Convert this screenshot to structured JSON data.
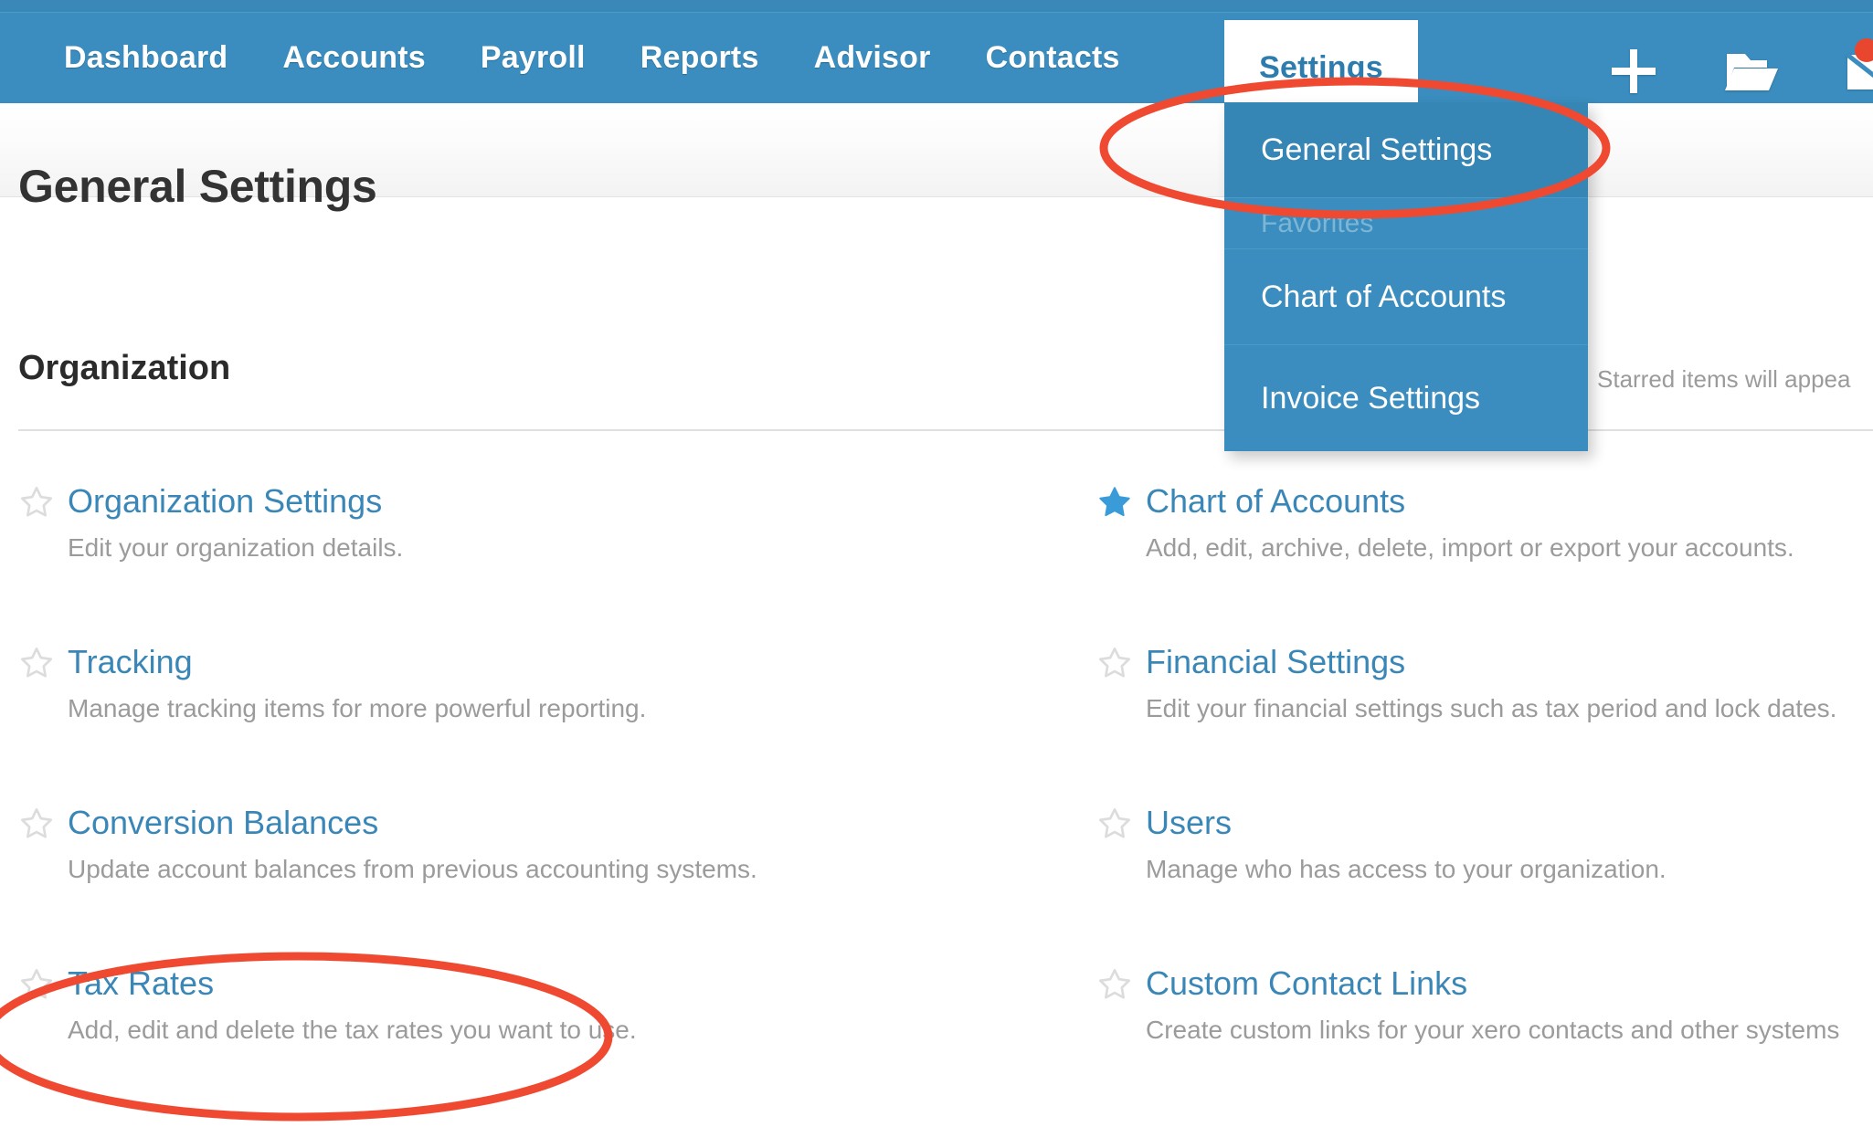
{
  "accent": "#3a8dbe",
  "link_color": "#3a87b7",
  "annotation_color": "#ef4a31",
  "nav": {
    "items": [
      {
        "label": "Dashboard",
        "name": "nav-item-dashboard"
      },
      {
        "label": "Accounts",
        "name": "nav-item-accounts"
      },
      {
        "label": "Payroll",
        "name": "nav-item-payroll"
      },
      {
        "label": "Reports",
        "name": "nav-item-reports"
      },
      {
        "label": "Advisor",
        "name": "nav-item-advisor"
      },
      {
        "label": "Contacts",
        "name": "nav-item-contacts"
      }
    ],
    "active_tab": "Settings",
    "icons": [
      {
        "name": "plus-icon",
        "glyph": "+"
      },
      {
        "name": "folder-icon",
        "glyph": "folder"
      },
      {
        "name": "mail-icon",
        "glyph": "envelope"
      }
    ]
  },
  "dropdown": {
    "selected_item": "General Settings",
    "section_label": "Favorites",
    "favorites": [
      "Chart of Accounts",
      "Invoice Settings"
    ]
  },
  "header": {
    "title": "General Settings"
  },
  "section": {
    "heading": "Organization",
    "starred_note": "Starred items will appea"
  },
  "settings": {
    "left_column": [
      {
        "title": "Organization Settings",
        "description": "Edit your organization details.",
        "starred": false
      },
      {
        "title": "Tracking",
        "description": "Manage tracking items for more powerful reporting.",
        "starred": false
      },
      {
        "title": "Conversion Balances",
        "description": "Update account balances from previous accounting systems.",
        "starred": false
      },
      {
        "title": "Tax Rates",
        "description": "Add, edit and delete the tax rates you want to use.",
        "starred": false
      }
    ],
    "right_column": [
      {
        "title": "Chart of Accounts",
        "description": "Add, edit, archive, delete, import or export your accounts.",
        "starred": true
      },
      {
        "title": "Financial Settings",
        "description": "Edit your financial settings such as tax period and lock dates.",
        "starred": false
      },
      {
        "title": "Users",
        "description": "Manage who has access to your organization.",
        "starred": false
      },
      {
        "title": "Custom Contact Links",
        "description": "Create custom links for your xero contacts and other systems",
        "starred": false
      }
    ]
  },
  "annotations": [
    {
      "name": "highlight-general-settings",
      "target": "General Settings"
    },
    {
      "name": "highlight-tax-rates",
      "target": "Tax Rates"
    }
  ]
}
